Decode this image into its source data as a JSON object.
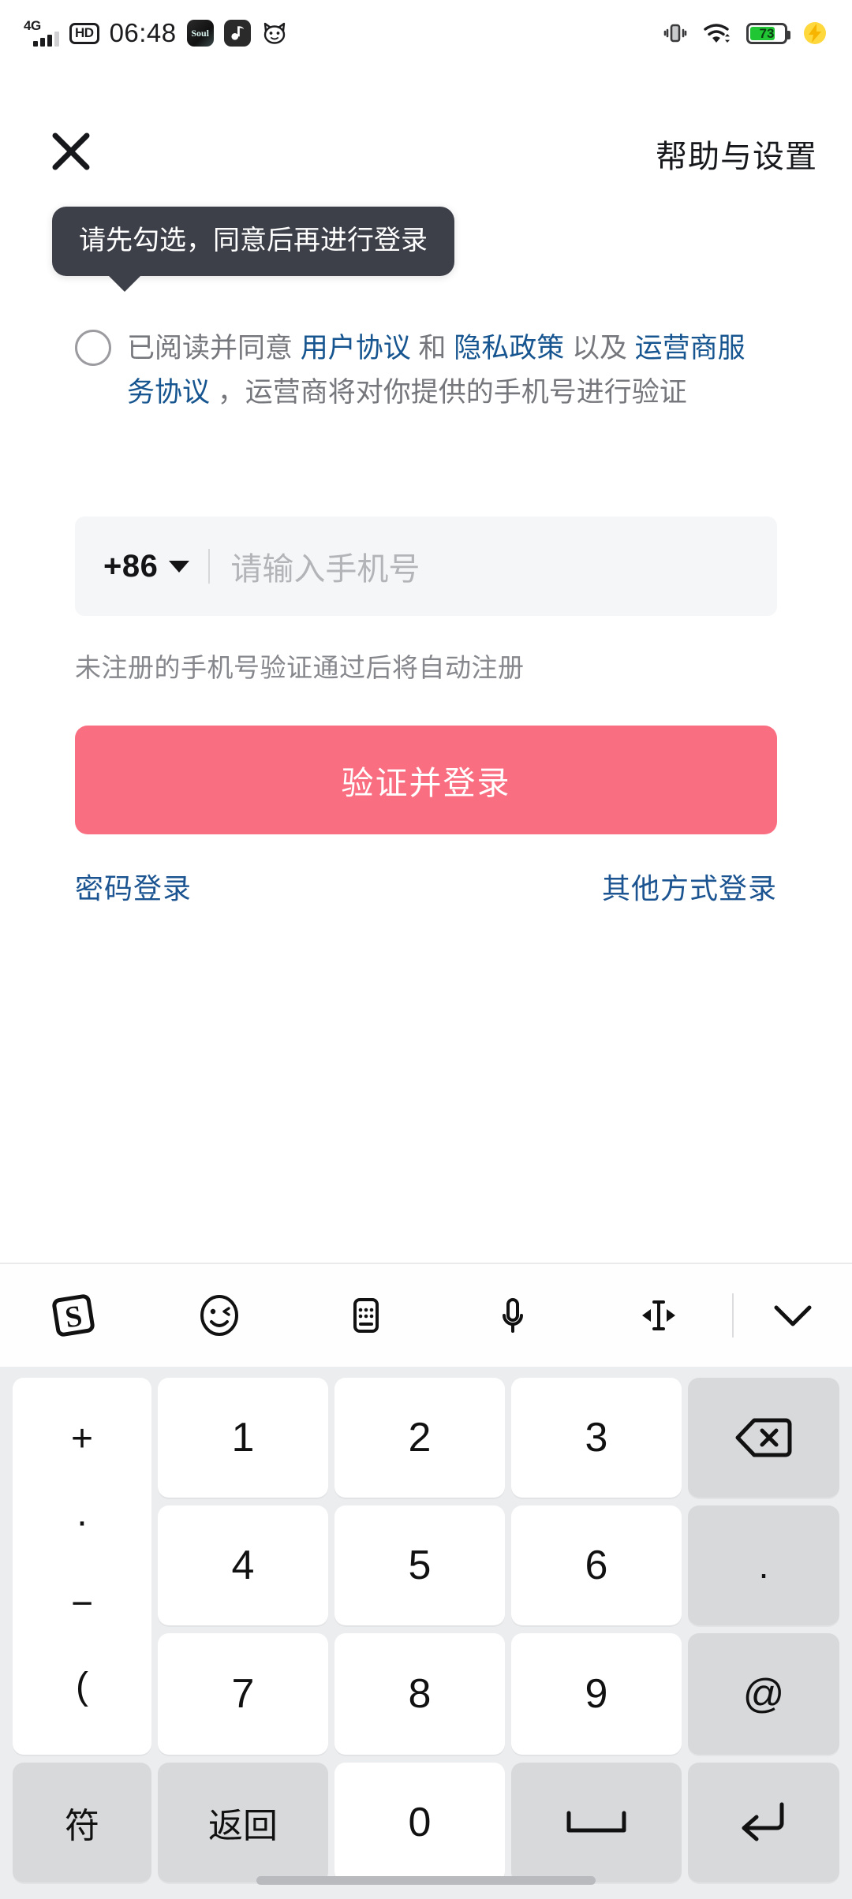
{
  "status_bar": {
    "network_label": "4G",
    "hd_label": "HD",
    "time": "06:48",
    "app_icons": [
      {
        "name": "soul-app-icon",
        "label": "Soul"
      },
      {
        "name": "music-app-icon",
        "label": ""
      },
      {
        "name": "cat-app-icon",
        "label": ""
      }
    ],
    "vibrate_icon": "vibrate-icon",
    "wifi_icon": "wifi-icon",
    "battery_percent": "73",
    "battery_level": 73,
    "charging_icon": "charging-bolt-icon"
  },
  "topnav": {
    "close_icon": "close-icon",
    "help_label": "帮助与设置"
  },
  "tooltip": {
    "message": "请先勾选，同意后再进行登录"
  },
  "agreement": {
    "checked": false,
    "prefix": "已阅读并同意 ",
    "link1": "用户协议",
    "mid1": " 和 ",
    "link2": "隐私政策",
    "mid2": " 以及 ",
    "link3": "运营商服务协议",
    "suffix": " ，运营商将对你提供的手机号进行验证"
  },
  "phone_input": {
    "country_code": "+86",
    "placeholder": "请输入手机号",
    "value": ""
  },
  "hint": "未注册的手机号验证通过后将自动注册",
  "primary_button": {
    "label": "验证并登录",
    "color": "#fa6e82"
  },
  "secondary_links": {
    "password_login": "密码登录",
    "other_login": "其他方式登录",
    "color": "#1b5490"
  },
  "keyboard": {
    "toolbar": [
      {
        "name": "sogou-logo-icon",
        "label": "S"
      },
      {
        "name": "emoji-icon",
        "label": ""
      },
      {
        "name": "keyboard-switch-icon",
        "label": ""
      },
      {
        "name": "microphone-icon",
        "label": ""
      },
      {
        "name": "cursor-move-icon",
        "label": ""
      },
      {
        "name": "collapse-keyboard-icon",
        "label": ""
      }
    ],
    "symbol_column": [
      "+",
      "·",
      "−",
      "("
    ],
    "keys": [
      {
        "label": "1",
        "style": "white"
      },
      {
        "label": "2",
        "style": "white"
      },
      {
        "label": "3",
        "style": "white"
      },
      {
        "label": "backspace",
        "style": "gray"
      },
      {
        "label": "4",
        "style": "white"
      },
      {
        "label": "5",
        "style": "white"
      },
      {
        "label": "6",
        "style": "white"
      },
      {
        "label": ".",
        "style": "gray"
      },
      {
        "label": "7",
        "style": "white"
      },
      {
        "label": "8",
        "style": "white"
      },
      {
        "label": "9",
        "style": "white"
      },
      {
        "label": "@",
        "style": "gray"
      },
      {
        "label": "符",
        "style": "gray"
      },
      {
        "label": "返回",
        "style": "gray"
      },
      {
        "label": "0",
        "style": "white"
      },
      {
        "label": "space",
        "style": "gray"
      },
      {
        "label": "enter",
        "style": "gray"
      }
    ]
  }
}
